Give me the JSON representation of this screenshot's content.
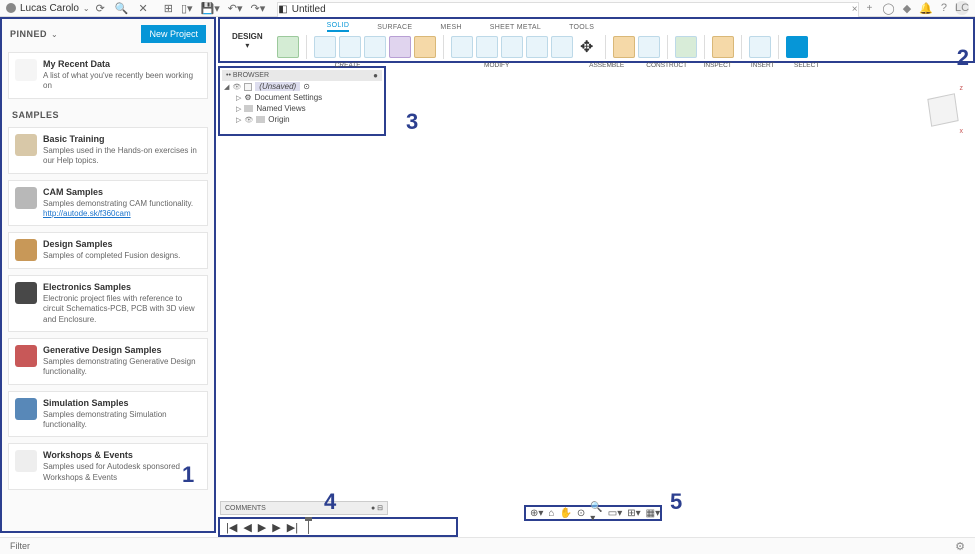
{
  "top": {
    "username": "Lucas Carolo",
    "tab_title": "Untitled",
    "avatar_initials": "LC"
  },
  "panel": {
    "pinned_label": "PINNED",
    "new_project": "New Project",
    "recent_title": "My Recent Data",
    "recent_desc": "A list of what you've recently been working on",
    "samples_label": "SAMPLES",
    "items": [
      {
        "title": "Basic Training",
        "desc": "Samples used in the Hands-on exercises in our Help topics."
      },
      {
        "title": "CAM Samples",
        "desc": "Samples demonstrating CAM functionality.",
        "link": "http://autode.sk/f360cam"
      },
      {
        "title": "Design Samples",
        "desc": "Samples of completed Fusion designs."
      },
      {
        "title": "Electronics Samples",
        "desc": "Electronic project files with reference to circuit Schematics-PCB, PCB with 3D view and Enclosure."
      },
      {
        "title": "Generative Design Samples",
        "desc": "Samples demonstrating Generative Design functionality."
      },
      {
        "title": "Simulation Samples",
        "desc": "Samples demonstrating Simulation functionality."
      },
      {
        "title": "Workshops & Events",
        "desc": "Samples used for Autodesk sponsored Workshops & Events"
      }
    ]
  },
  "ribbon": {
    "design_label": "DESIGN",
    "tabs": {
      "solid": "SOLID",
      "surface": "SURFACE",
      "mesh": "MESH",
      "sheet": "SHEET METAL",
      "tools": "TOOLS"
    },
    "groups": {
      "create": "CREATE",
      "modify": "MODIFY",
      "assemble": "ASSEMBLE",
      "construct": "CONSTRUCT",
      "inspect": "INSPECT",
      "insert": "INSERT",
      "select": "SELECT"
    }
  },
  "browser": {
    "header": "BROWSER",
    "root": "(Unsaved)",
    "doc_settings": "Document Settings",
    "named_views": "Named Views",
    "origin": "Origin"
  },
  "comments_label": "COMMENTS",
  "filter_label": "Filter",
  "annotations": {
    "n1": "1",
    "n2": "2",
    "n3": "3",
    "n4": "4",
    "n5": "5"
  }
}
